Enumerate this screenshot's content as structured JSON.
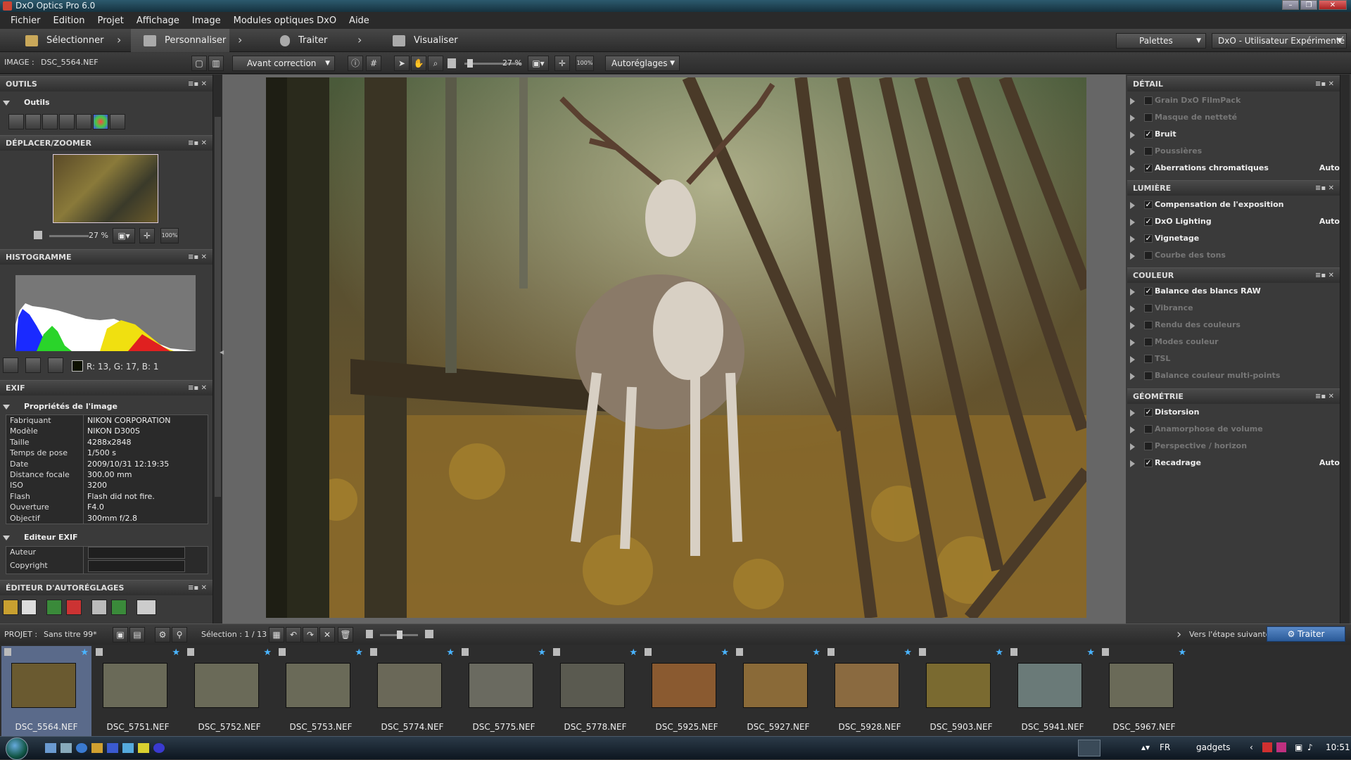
{
  "window": {
    "title": "DxO Optics Pro 6.0"
  },
  "menu": [
    "Fichier",
    "Edition",
    "Projet",
    "Affichage",
    "Image",
    "Modules optiques DxO",
    "Aide"
  ],
  "steps": [
    "Sélectionner",
    "Personnaliser",
    "Traiter",
    "Visualiser"
  ],
  "topright": {
    "palettes": "Palettes",
    "user": "DxO - Utilisateur Expérimenté"
  },
  "toolbar": {
    "image_label": "IMAGE :",
    "image_name": "DSC_5564.NEF",
    "compare": "Avant correction",
    "zoom": "27 %",
    "zoom_100": "100%",
    "autoreglages": "Autoréglages"
  },
  "left": {
    "outils_header": "OUTILS",
    "outils_sub": "Outils",
    "deplacer_header": "DÉPLACER/ZOOMER",
    "nav_zoom": "27 %",
    "nav_100": "100%",
    "histo_header": "HISTOGRAMME",
    "rgb": "R: 13, G: 17, B:  1",
    "exif_header": "EXIF",
    "props_sub": "Propriétés de l'image",
    "exif": [
      {
        "k": "Fabriquant",
        "v": "NIKON CORPORATION"
      },
      {
        "k": "Modèle",
        "v": "NIKON D300S"
      },
      {
        "k": "Taille",
        "v": "4288x2848"
      },
      {
        "k": "Temps de pose",
        "v": "1/500 s"
      },
      {
        "k": "Date",
        "v": "2009/10/31 12:19:35"
      },
      {
        "k": "Distance focale",
        "v": "300.00 mm"
      },
      {
        "k": "ISO",
        "v": "3200"
      },
      {
        "k": "Flash",
        "v": "Flash did not fire."
      },
      {
        "k": "Ouverture",
        "v": "F4.0"
      },
      {
        "k": "Objectif",
        "v": "300mm f/2.8"
      }
    ],
    "editeur_sub": "Editeur EXIF",
    "auteur": "Auteur",
    "copyright": "Copyright",
    "autoreglages_header": "ÉDITEUR D'AUTORÉGLAGES"
  },
  "right": {
    "detail_header": "DÉTAIL",
    "detail": [
      {
        "label": "Grain DxO FilmPack",
        "checked": false,
        "auto": ""
      },
      {
        "label": "Masque de netteté",
        "checked": false,
        "auto": ""
      },
      {
        "label": "Bruit",
        "checked": true,
        "auto": ""
      },
      {
        "label": "Poussières",
        "checked": false,
        "auto": ""
      },
      {
        "label": "Aberrations chromatiques",
        "checked": true,
        "auto": "Auto"
      }
    ],
    "lumiere_header": "LUMIÈRE",
    "lumiere": [
      {
        "label": "Compensation de l'exposition",
        "checked": true,
        "auto": ""
      },
      {
        "label": "DxO Lighting",
        "checked": true,
        "auto": "Auto"
      },
      {
        "label": "Vignetage",
        "checked": true,
        "auto": ""
      },
      {
        "label": "Courbe des tons",
        "checked": false,
        "auto": ""
      }
    ],
    "couleur_header": "COULEUR",
    "couleur": [
      {
        "label": "Balance des blancs RAW",
        "checked": true,
        "auto": ""
      },
      {
        "label": "Vibrance",
        "checked": false,
        "auto": ""
      },
      {
        "label": "Rendu des couleurs",
        "checked": false,
        "auto": ""
      },
      {
        "label": "Modes couleur",
        "checked": false,
        "auto": ""
      },
      {
        "label": "TSL",
        "checked": false,
        "auto": ""
      },
      {
        "label": "Balance couleur multi-points",
        "checked": false,
        "auto": ""
      }
    ],
    "geometrie_header": "GÉOMÉTRIE",
    "geometrie": [
      {
        "label": "Distorsion",
        "checked": true,
        "auto": ""
      },
      {
        "label": "Anamorphose de volume",
        "checked": false,
        "auto": ""
      },
      {
        "label": "Perspective / horizon",
        "checked": false,
        "auto": ""
      },
      {
        "label": "Recadrage",
        "checked": true,
        "auto": "Auto"
      }
    ]
  },
  "project": {
    "label": "PROJET :",
    "name": "Sans titre 99*",
    "selection": "Sélection : 1 / 13",
    "next": "Vers l'étape suivante",
    "process": "Traiter"
  },
  "thumbnails": [
    "DSC_5564.NEF",
    "DSC_5751.NEF",
    "DSC_5752.NEF",
    "DSC_5753.NEF",
    "DSC_5774.NEF",
    "DSC_5775.NEF",
    "DSC_5778.NEF",
    "DSC_5925.NEF",
    "DSC_5927.NEF",
    "DSC_5928.NEF",
    "DSC_5903.NEF",
    "DSC_5941.NEF",
    "DSC_5967.NEF"
  ],
  "taskbar": {
    "lang": "FR",
    "gadgets": "gadgets",
    "time": "10:51"
  }
}
